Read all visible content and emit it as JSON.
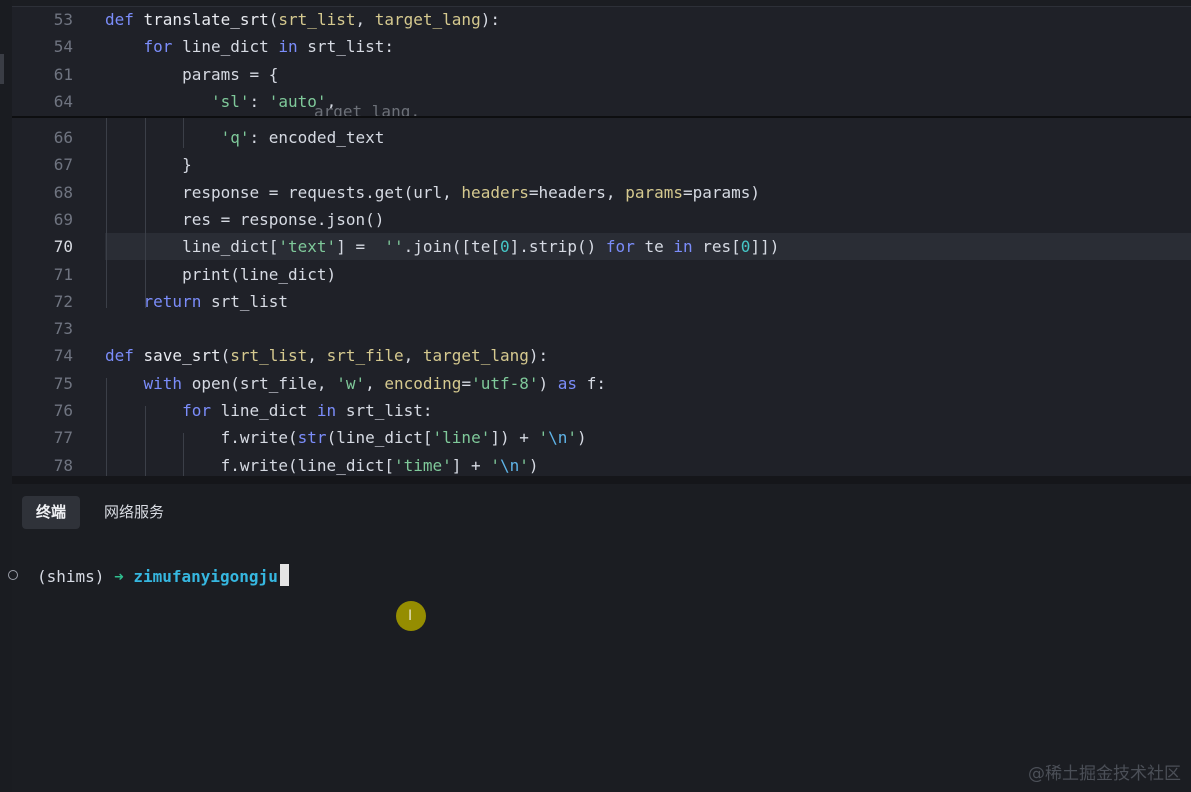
{
  "editor": {
    "sticky": [
      {
        "num": "53",
        "tokens": [
          {
            "t": "kw",
            "v": "def "
          },
          {
            "t": "fn",
            "v": "translate_srt"
          },
          {
            "t": "op",
            "v": "("
          },
          {
            "t": "pa",
            "v": "srt_list"
          },
          {
            "t": "op",
            "v": ", "
          },
          {
            "t": "pa",
            "v": "target_lang"
          },
          {
            "t": "op",
            "v": "):"
          }
        ]
      },
      {
        "num": "54",
        "tokens": [
          {
            "t": "op",
            "v": "    "
          },
          {
            "t": "kw",
            "v": "for "
          },
          {
            "t": "op",
            "v": "line_dict "
          },
          {
            "t": "kw",
            "v": "in "
          },
          {
            "t": "op",
            "v": "srt_list:"
          }
        ]
      },
      {
        "num": "61",
        "tokens": [
          {
            "t": "op",
            "v": "        params = {"
          }
        ]
      },
      {
        "num": "64",
        "tokens": [
          {
            "t": "op",
            "v": "           "
          },
          {
            "t": "st",
            "v": "'sl'"
          },
          {
            "t": "op",
            "v": ": "
          },
          {
            "t": "st",
            "v": "'auto'"
          },
          {
            "t": "op",
            "v": ","
          }
        ]
      }
    ],
    "ghost_text": "arget_lang,",
    "lines": [
      {
        "num": "66",
        "tokens": [
          {
            "t": "op",
            "v": "            "
          },
          {
            "t": "st",
            "v": "'q'"
          },
          {
            "t": "op",
            "v": ": encoded_text"
          }
        ]
      },
      {
        "num": "67",
        "tokens": [
          {
            "t": "op",
            "v": "        }"
          }
        ]
      },
      {
        "num": "68",
        "tokens": [
          {
            "t": "op",
            "v": "        response = requests.get(url, "
          },
          {
            "t": "pa",
            "v": "headers"
          },
          {
            "t": "op",
            "v": "=headers, "
          },
          {
            "t": "pa",
            "v": "params"
          },
          {
            "t": "op",
            "v": "=params)"
          }
        ]
      },
      {
        "num": "69",
        "tokens": [
          {
            "t": "op",
            "v": "        res = response.json()"
          }
        ]
      },
      {
        "num": "70",
        "active": true,
        "tokens": [
          {
            "t": "op",
            "v": "        line_dict["
          },
          {
            "t": "st",
            "v": "'text'"
          },
          {
            "t": "op",
            "v": "] =  "
          },
          {
            "t": "st",
            "v": "''"
          },
          {
            "t": "op",
            "v": ".join([te["
          },
          {
            "t": "nu",
            "v": "0"
          },
          {
            "t": "op",
            "v": "].strip() "
          },
          {
            "t": "kw",
            "v": "for "
          },
          {
            "t": "op",
            "v": "te "
          },
          {
            "t": "kw",
            "v": "in "
          },
          {
            "t": "op",
            "v": "res["
          },
          {
            "t": "nu",
            "v": "0"
          },
          {
            "t": "op",
            "v": "]])"
          }
        ]
      },
      {
        "num": "71",
        "tokens": [
          {
            "t": "op",
            "v": "        print(line_dict)"
          }
        ]
      },
      {
        "num": "72",
        "tokens": [
          {
            "t": "op",
            "v": "    "
          },
          {
            "t": "kw",
            "v": "return "
          },
          {
            "t": "op",
            "v": "srt_list"
          }
        ]
      },
      {
        "num": "73",
        "tokens": []
      },
      {
        "num": "74",
        "tokens": [
          {
            "t": "kw",
            "v": "def "
          },
          {
            "t": "fn",
            "v": "save_srt"
          },
          {
            "t": "op",
            "v": "("
          },
          {
            "t": "pa",
            "v": "srt_list"
          },
          {
            "t": "op",
            "v": ", "
          },
          {
            "t": "pa",
            "v": "srt_file"
          },
          {
            "t": "op",
            "v": ", "
          },
          {
            "t": "pa",
            "v": "target_lang"
          },
          {
            "t": "op",
            "v": "):"
          }
        ]
      },
      {
        "num": "75",
        "tokens": [
          {
            "t": "op",
            "v": "    "
          },
          {
            "t": "kw",
            "v": "with "
          },
          {
            "t": "op",
            "v": "open(srt_file, "
          },
          {
            "t": "st",
            "v": "'w'"
          },
          {
            "t": "op",
            "v": ", "
          },
          {
            "t": "pa",
            "v": "encoding"
          },
          {
            "t": "op",
            "v": "="
          },
          {
            "t": "st",
            "v": "'utf-8'"
          },
          {
            "t": "op",
            "v": ") "
          },
          {
            "t": "kw",
            "v": "as "
          },
          {
            "t": "op",
            "v": "f:"
          }
        ]
      },
      {
        "num": "76",
        "tokens": [
          {
            "t": "op",
            "v": "        "
          },
          {
            "t": "kw",
            "v": "for "
          },
          {
            "t": "op",
            "v": "line_dict "
          },
          {
            "t": "kw",
            "v": "in "
          },
          {
            "t": "op",
            "v": "srt_list:"
          }
        ]
      },
      {
        "num": "77",
        "tokens": [
          {
            "t": "op",
            "v": "            f.write("
          },
          {
            "t": "kw",
            "v": "str"
          },
          {
            "t": "op",
            "v": "(line_dict["
          },
          {
            "t": "st",
            "v": "'line'"
          },
          {
            "t": "op",
            "v": "]) + "
          },
          {
            "t": "st",
            "v": "'"
          },
          {
            "t": "esc",
            "v": "\\n"
          },
          {
            "t": "st",
            "v": "'"
          },
          {
            "t": "op",
            "v": ")"
          }
        ]
      },
      {
        "num": "78",
        "tokens": [
          {
            "t": "op",
            "v": "            f.write(line_dict["
          },
          {
            "t": "st",
            "v": "'time'"
          },
          {
            "t": "op",
            "v": "] + "
          },
          {
            "t": "st",
            "v": "'"
          },
          {
            "t": "esc",
            "v": "\\n"
          },
          {
            "t": "st",
            "v": "'"
          },
          {
            "t": "op",
            "v": ")"
          }
        ]
      }
    ]
  },
  "terminal": {
    "tabs": [
      "终端",
      "网络服务"
    ],
    "prompt_env": "(shims) ",
    "prompt_arrow": "➜",
    "prompt_dir": " zimufanyigongju"
  },
  "watermark": "@稀土掘金技术社区",
  "colors": {
    "keyword": "#7b8dfa",
    "string": "#7fc99a",
    "param": "#d5c98f",
    "number": "#45c6c6",
    "arrow": "#2fbf8f",
    "dir": "#36b7e0"
  }
}
